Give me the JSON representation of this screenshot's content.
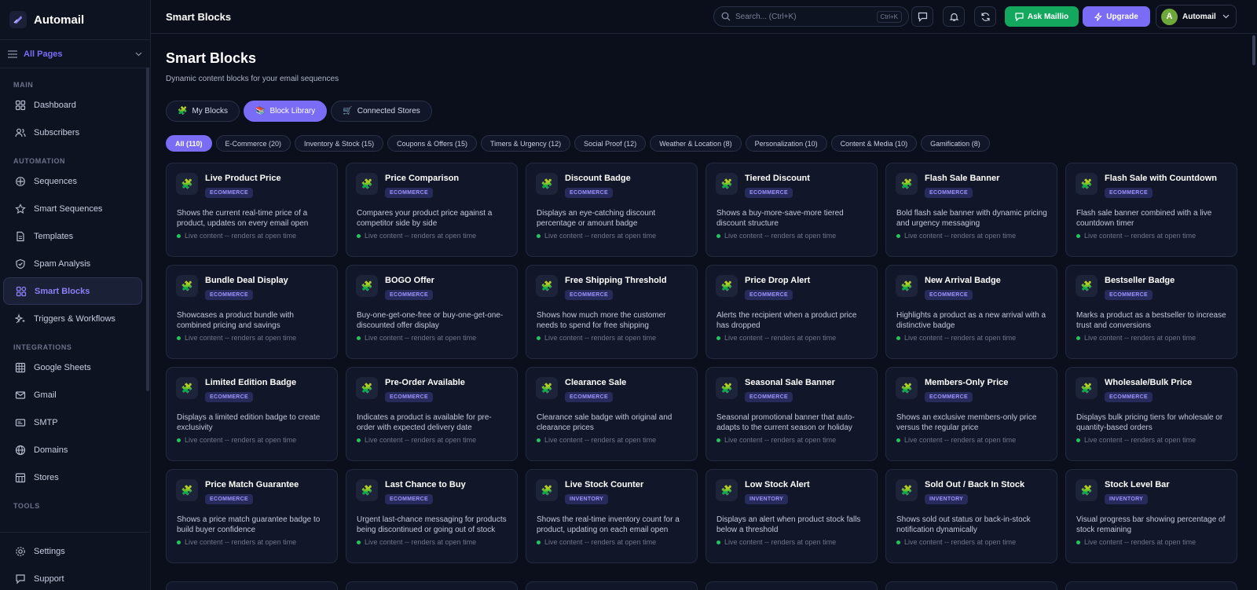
{
  "app": {
    "name": "Automail",
    "page_selector": "All Pages"
  },
  "sidebar": {
    "sections": [
      {
        "label": "MAIN",
        "items": [
          {
            "label": "Dashboard",
            "icon": "dashboard-icon"
          },
          {
            "label": "Subscribers",
            "icon": "users-icon"
          }
        ]
      },
      {
        "label": "AUTOMATION",
        "items": [
          {
            "label": "Sequences",
            "icon": "sequences-icon"
          },
          {
            "label": "Smart Sequences",
            "icon": "star-icon"
          },
          {
            "label": "Templates",
            "icon": "template-icon"
          },
          {
            "label": "Spam Analysis",
            "icon": "shield-icon"
          },
          {
            "label": "Smart Blocks",
            "icon": "blocks-icon",
            "active": true
          },
          {
            "label": "Triggers & Workflows",
            "icon": "workflow-icon"
          }
        ]
      },
      {
        "label": "INTEGRATIONS",
        "items": [
          {
            "label": "Google Sheets",
            "icon": "sheets-icon"
          },
          {
            "label": "Gmail",
            "icon": "mail-icon"
          },
          {
            "label": "SMTP",
            "icon": "smtp-icon"
          },
          {
            "label": "Domains",
            "icon": "globe-icon"
          },
          {
            "label": "Stores",
            "icon": "store-icon"
          }
        ]
      },
      {
        "label": "TOOLS",
        "items": []
      }
    ],
    "bottom": [
      {
        "label": "Settings",
        "icon": "gear-icon"
      },
      {
        "label": "Support",
        "icon": "chat-icon"
      }
    ]
  },
  "topbar": {
    "title": "Smart Blocks",
    "search_placeholder": "Search... (Ctrl+K)",
    "search_shortcut": "Ctrl+K",
    "ask_label": "Ask Maillio",
    "upgrade_label": "Upgrade",
    "user_initial": "A",
    "user_name": "Automail"
  },
  "main": {
    "title": "Smart Blocks",
    "subtitle": "Dynamic content blocks for your email sequences",
    "tabs": [
      {
        "label": "My Blocks",
        "emoji": "🧩"
      },
      {
        "label": "Block Library",
        "emoji": "📚",
        "active": true
      },
      {
        "label": "Connected Stores",
        "emoji": "🛒"
      }
    ],
    "filters": [
      {
        "label": "All (110)",
        "active": true
      },
      {
        "label": "E-Commerce (20)"
      },
      {
        "label": "Inventory & Stock (15)"
      },
      {
        "label": "Coupons & Offers (15)"
      },
      {
        "label": "Timers & Urgency (12)"
      },
      {
        "label": "Social Proof (12)"
      },
      {
        "label": "Weather & Location (8)"
      },
      {
        "label": "Personalization (10)"
      },
      {
        "label": "Content & Media (10)"
      },
      {
        "label": "Gamification (8)"
      }
    ],
    "live_text": "Live content -- renders at open time",
    "cards": [
      {
        "title": "Live Product Price",
        "badge": "ECOMMERCE",
        "desc": "Shows the current real-time price of a product, updates on every email open"
      },
      {
        "title": "Price Comparison",
        "badge": "ECOMMERCE",
        "desc": "Compares your product price against a competitor side by side"
      },
      {
        "title": "Discount Badge",
        "badge": "ECOMMERCE",
        "desc": "Displays an eye-catching discount percentage or amount badge"
      },
      {
        "title": "Tiered Discount",
        "badge": "ECOMMERCE",
        "desc": "Shows a buy-more-save-more tiered discount structure"
      },
      {
        "title": "Flash Sale Banner",
        "badge": "ECOMMERCE",
        "desc": "Bold flash sale banner with dynamic pricing and urgency messaging"
      },
      {
        "title": "Flash Sale with Countdown",
        "badge": "ECOMMERCE",
        "desc": "Flash sale banner combined with a live countdown timer"
      },
      {
        "title": "Bundle Deal Display",
        "badge": "ECOMMERCE",
        "desc": "Showcases a product bundle with combined pricing and savings"
      },
      {
        "title": "BOGO Offer",
        "badge": "ECOMMERCE",
        "desc": "Buy-one-get-one-free or buy-one-get-one-discounted offer display"
      },
      {
        "title": "Free Shipping Threshold",
        "badge": "ECOMMERCE",
        "desc": "Shows how much more the customer needs to spend for free shipping"
      },
      {
        "title": "Price Drop Alert",
        "badge": "ECOMMERCE",
        "desc": "Alerts the recipient when a product price has dropped"
      },
      {
        "title": "New Arrival Badge",
        "badge": "ECOMMERCE",
        "desc": "Highlights a product as a new arrival with a distinctive badge"
      },
      {
        "title": "Bestseller Badge",
        "badge": "ECOMMERCE",
        "desc": "Marks a product as a bestseller to increase trust and conversions"
      },
      {
        "title": "Limited Edition Badge",
        "badge": "ECOMMERCE",
        "desc": "Displays a limited edition badge to create exclusivity"
      },
      {
        "title": "Pre-Order Available",
        "badge": "ECOMMERCE",
        "desc": "Indicates a product is available for pre-order with expected delivery date"
      },
      {
        "title": "Clearance Sale",
        "badge": "ECOMMERCE",
        "desc": "Clearance sale badge with original and clearance prices"
      },
      {
        "title": "Seasonal Sale Banner",
        "badge": "ECOMMERCE",
        "desc": "Seasonal promotional banner that auto-adapts to the current season or holiday"
      },
      {
        "title": "Members-Only Price",
        "badge": "ECOMMERCE",
        "desc": "Shows an exclusive members-only price versus the regular price"
      },
      {
        "title": "Wholesale/Bulk Price",
        "badge": "ECOMMERCE",
        "desc": "Displays bulk pricing tiers for wholesale or quantity-based orders"
      },
      {
        "title": "Price Match Guarantee",
        "badge": "ECOMMERCE",
        "desc": "Shows a price match guarantee badge to build buyer confidence"
      },
      {
        "title": "Last Chance to Buy",
        "badge": "ECOMMERCE",
        "desc": "Urgent last-chance messaging for products being discontinued or going out of stock"
      },
      {
        "title": "Live Stock Counter",
        "badge": "INVENTORY",
        "desc": "Shows the real-time inventory count for a product, updating on each email open"
      },
      {
        "title": "Low Stock Alert",
        "badge": "INVENTORY",
        "desc": "Displays an alert when product stock falls below a threshold"
      },
      {
        "title": "Sold Out / Back In Stock",
        "badge": "INVENTORY",
        "desc": "Shows sold out status or back-in-stock notification dynamically"
      },
      {
        "title": "Stock Level Bar",
        "badge": "INVENTORY",
        "desc": "Visual progress bar showing percentage of stock remaining"
      }
    ]
  }
}
